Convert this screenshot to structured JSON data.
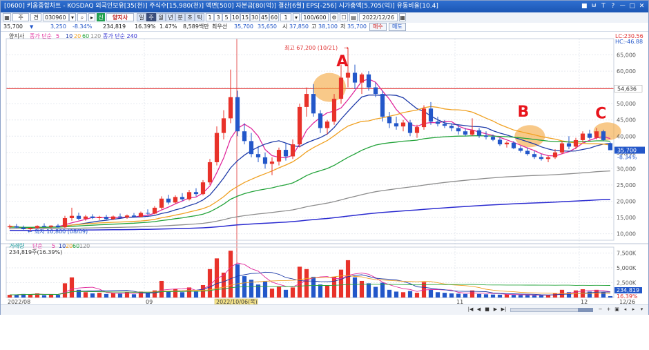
{
  "window": {
    "title": "[0600] 키움종합차트 - KOSDAQ 외국인보유[35(천)] 주식수[15,980(천)] 액면[500] 자본금[80(억)] 결산[6월] EPS[-256] 시가총액[5,705(억)] 유동비율[10.4]",
    "buttons": [
      "■",
      "ㅂ",
      "T",
      "?",
      "ㅡ",
      "□",
      "✕"
    ]
  },
  "toolbar": {
    "mode": "주",
    "market": "견",
    "code": "030960",
    "stock_name": "양지사",
    "periods": [
      "일",
      "주",
      "월",
      "년",
      "분",
      "초",
      "틱"
    ],
    "minute_options": [
      "1",
      "3",
      "5",
      "10",
      "15",
      "30",
      "45",
      "60"
    ],
    "interval_value": "1",
    "count_display": "100/600",
    "date": "2022/12/26"
  },
  "quote": {
    "price": "35,700",
    "change": "3,250",
    "change_pct": "-8.34%",
    "volume": "234,819",
    "turnover": "16.39%",
    "ratio": "1.47%",
    "amount": "8,589백만",
    "priority_label": "최우선",
    "priority_ask": "35,700",
    "priority_bid": "35,650",
    "open_label": "시",
    "open": "37,850",
    "high_label": "고",
    "high": "38,100",
    "low_label": "저",
    "low": "35,700",
    "buy_label": "매수",
    "sell_label": "매도"
  },
  "colors": {
    "up": "#e8322a",
    "down": "#2357c9",
    "ma5": "#e0289c",
    "ma10": "#1e3aa8",
    "ma20": "#f0a020",
    "ma60": "#23a33a",
    "ma120": "#8c8c8c",
    "ma240": "#2b2bd0",
    "highlight": "#f3a53a",
    "resistance": "#e03030"
  },
  "chart_data": {
    "type": "candlestick",
    "legend": {
      "stock": "양지사",
      "ma_label": "종가 단순",
      "ma_periods": [
        "5",
        "10",
        "20",
        "60",
        "120"
      ],
      "ma240_label": "종가 단순 240"
    },
    "y_price_ticks": [
      "65,000",
      "60,000",
      "55,000",
      "50,000",
      "45,000",
      "40,000",
      "35,000",
      "30,000",
      "25,000",
      "20,000",
      "15,000",
      "10,000"
    ],
    "y_price_range": [
      8000,
      70000
    ],
    "x_labels": [
      "2022/08",
      "09",
      "2022/10/06(목)",
      "11",
      "12",
      "12/26"
    ],
    "lc_label": "LC:230.56",
    "hc_label": "HC:-46.88",
    "resistance": {
      "value": 54636,
      "label": "54,636"
    },
    "last_price_label": "35,700",
    "last_change_label": "-8.34%",
    "max_annotation": "최고 67,200 (10/21)",
    "min_annotation": "최저 10,800 (08/09)",
    "markers": [
      "A",
      "B",
      "C"
    ],
    "candles": [
      {
        "o": 12000,
        "h": 12800,
        "l": 11500,
        "c": 12300
      },
      {
        "o": 12300,
        "h": 13000,
        "l": 11800,
        "c": 11900
      },
      {
        "o": 11900,
        "h": 12500,
        "l": 11200,
        "c": 11400
      },
      {
        "o": 11400,
        "h": 12000,
        "l": 10800,
        "c": 11800
      },
      {
        "o": 11800,
        "h": 12600,
        "l": 11500,
        "c": 12400
      },
      {
        "o": 12400,
        "h": 13200,
        "l": 12000,
        "c": 12100
      },
      {
        "o": 12100,
        "h": 12600,
        "l": 11700,
        "c": 12500
      },
      {
        "o": 12500,
        "h": 13000,
        "l": 11900,
        "c": 12000
      },
      {
        "o": 12000,
        "h": 15500,
        "l": 11800,
        "c": 14800
      },
      {
        "o": 14800,
        "h": 18000,
        "l": 14000,
        "c": 15500
      },
      {
        "o": 15500,
        "h": 16500,
        "l": 14200,
        "c": 14600
      },
      {
        "o": 14600,
        "h": 15800,
        "l": 14000,
        "c": 15300
      },
      {
        "o": 15300,
        "h": 16000,
        "l": 14500,
        "c": 14800
      },
      {
        "o": 14800,
        "h": 15500,
        "l": 14200,
        "c": 15200
      },
      {
        "o": 15200,
        "h": 15800,
        "l": 14300,
        "c": 14500
      },
      {
        "o": 14500,
        "h": 15600,
        "l": 14200,
        "c": 15300
      },
      {
        "o": 15300,
        "h": 16200,
        "l": 14800,
        "c": 15000
      },
      {
        "o": 15000,
        "h": 15900,
        "l": 14600,
        "c": 15600
      },
      {
        "o": 15600,
        "h": 16400,
        "l": 15000,
        "c": 15200
      },
      {
        "o": 15200,
        "h": 16800,
        "l": 15000,
        "c": 16400
      },
      {
        "o": 16400,
        "h": 17500,
        "l": 15800,
        "c": 16200
      },
      {
        "o": 16200,
        "h": 18500,
        "l": 16000,
        "c": 18000
      },
      {
        "o": 18000,
        "h": 21500,
        "l": 17500,
        "c": 20800
      },
      {
        "o": 20800,
        "h": 22000,
        "l": 19000,
        "c": 19600
      },
      {
        "o": 19600,
        "h": 21800,
        "l": 19200,
        "c": 21300
      },
      {
        "o": 21300,
        "h": 22500,
        "l": 20000,
        "c": 20600
      },
      {
        "o": 20600,
        "h": 23500,
        "l": 20200,
        "c": 22800
      },
      {
        "o": 22800,
        "h": 24000,
        "l": 21500,
        "c": 22200
      },
      {
        "o": 22200,
        "h": 26500,
        "l": 21800,
        "c": 25800
      },
      {
        "o": 25800,
        "h": 33000,
        "l": 25000,
        "c": 32000
      },
      {
        "o": 32000,
        "h": 43000,
        "l": 31000,
        "c": 41000
      },
      {
        "o": 41000,
        "h": 48000,
        "l": 39000,
        "c": 45500
      },
      {
        "o": 45500,
        "h": 60500,
        "l": 44000,
        "c": 52000
      },
      {
        "o": 52000,
        "h": 54000,
        "l": 40000,
        "c": 41500
      },
      {
        "o": 41500,
        "h": 44000,
        "l": 37500,
        "c": 38500
      },
      {
        "o": 38500,
        "h": 41000,
        "l": 33500,
        "c": 34500
      },
      {
        "o": 34500,
        "h": 37000,
        "l": 32000,
        "c": 33500
      },
      {
        "o": 33500,
        "h": 35000,
        "l": 30000,
        "c": 31500
      },
      {
        "o": 31500,
        "h": 33500,
        "l": 28000,
        "c": 32200
      },
      {
        "o": 32200,
        "h": 36500,
        "l": 31000,
        "c": 35800
      },
      {
        "o": 35800,
        "h": 38000,
        "l": 32500,
        "c": 33800
      },
      {
        "o": 33800,
        "h": 39000,
        "l": 33000,
        "c": 37500
      },
      {
        "o": 37500,
        "h": 50000,
        "l": 36500,
        "c": 49000
      },
      {
        "o": 49000,
        "h": 55000,
        "l": 46000,
        "c": 53000
      },
      {
        "o": 53000,
        "h": 56000,
        "l": 46000,
        "c": 47000
      },
      {
        "o": 47000,
        "h": 48000,
        "l": 41000,
        "c": 42500
      },
      {
        "o": 42500,
        "h": 45000,
        "l": 40500,
        "c": 44500
      },
      {
        "o": 44500,
        "h": 53000,
        "l": 43500,
        "c": 51500
      },
      {
        "o": 51500,
        "h": 62000,
        "l": 50000,
        "c": 58000
      },
      {
        "o": 58000,
        "h": 67200,
        "l": 55000,
        "c": 59500
      },
      {
        "o": 59500,
        "h": 62000,
        "l": 54500,
        "c": 56500
      },
      {
        "o": 56500,
        "h": 59500,
        "l": 53000,
        "c": 59000
      },
      {
        "o": 59000,
        "h": 60000,
        "l": 54000,
        "c": 55000
      },
      {
        "o": 55000,
        "h": 56500,
        "l": 52000,
        "c": 53000
      },
      {
        "o": 53000,
        "h": 54000,
        "l": 44500,
        "c": 46000
      },
      {
        "o": 46000,
        "h": 47500,
        "l": 42500,
        "c": 44000
      },
      {
        "o": 44000,
        "h": 46000,
        "l": 42000,
        "c": 43000
      },
      {
        "o": 43000,
        "h": 45000,
        "l": 41500,
        "c": 44200
      },
      {
        "o": 44200,
        "h": 45000,
        "l": 40000,
        "c": 41000
      },
      {
        "o": 41000,
        "h": 43500,
        "l": 39500,
        "c": 42800
      },
      {
        "o": 42800,
        "h": 49500,
        "l": 42000,
        "c": 48500
      },
      {
        "o": 48500,
        "h": 50500,
        "l": 43500,
        "c": 44500
      },
      {
        "o": 44500,
        "h": 46000,
        "l": 43000,
        "c": 43800
      },
      {
        "o": 43800,
        "h": 45000,
        "l": 42500,
        "c": 43200
      },
      {
        "o": 43200,
        "h": 44000,
        "l": 41500,
        "c": 42500
      },
      {
        "o": 42500,
        "h": 43500,
        "l": 40500,
        "c": 41500
      },
      {
        "o": 41500,
        "h": 42500,
        "l": 40000,
        "c": 40500
      },
      {
        "o": 40500,
        "h": 45500,
        "l": 40000,
        "c": 41800
      },
      {
        "o": 41800,
        "h": 42500,
        "l": 39500,
        "c": 40200
      },
      {
        "o": 40200,
        "h": 41500,
        "l": 39000,
        "c": 39800
      },
      {
        "o": 39800,
        "h": 40500,
        "l": 38500,
        "c": 38900
      },
      {
        "o": 38900,
        "h": 39500,
        "l": 37000,
        "c": 37500
      },
      {
        "o": 37500,
        "h": 38500,
        "l": 36500,
        "c": 38000
      },
      {
        "o": 38000,
        "h": 38500,
        "l": 36000,
        "c": 36300
      },
      {
        "o": 36300,
        "h": 37000,
        "l": 35000,
        "c": 35500
      },
      {
        "o": 35500,
        "h": 36500,
        "l": 34000,
        "c": 34500
      },
      {
        "o": 34500,
        "h": 35500,
        "l": 33000,
        "c": 33600
      },
      {
        "o": 33600,
        "h": 34500,
        "l": 32500,
        "c": 33000
      },
      {
        "o": 33000,
        "h": 34000,
        "l": 32000,
        "c": 33500
      },
      {
        "o": 33500,
        "h": 36000,
        "l": 33000,
        "c": 35000
      },
      {
        "o": 35000,
        "h": 38500,
        "l": 34500,
        "c": 37800
      },
      {
        "o": 37800,
        "h": 40000,
        "l": 36000,
        "c": 36800
      },
      {
        "o": 36800,
        "h": 39500,
        "l": 36000,
        "c": 38800
      },
      {
        "o": 38800,
        "h": 41500,
        "l": 38000,
        "c": 40800
      },
      {
        "o": 40800,
        "h": 42000,
        "l": 39000,
        "c": 39500
      },
      {
        "o": 39500,
        "h": 42500,
        "l": 39000,
        "c": 41500
      },
      {
        "o": 41500,
        "h": 42000,
        "l": 38500,
        "c": 38800
      },
      {
        "o": 37850,
        "h": 38100,
        "l": 35700,
        "c": 35700
      }
    ],
    "volume_legend": {
      "label": "거래량",
      "ma_label": "단순",
      "ma_periods": [
        "5",
        "10",
        "20",
        "60",
        "120"
      ],
      "summary": "234,819주(16.39%)"
    },
    "volume_ticks": [
      "7,500K",
      "5,000K",
      "2,500K"
    ],
    "volume_range": [
      0,
      8500000
    ],
    "volume_last_labels": [
      "234,819",
      "16.39%"
    ],
    "volumes": [
      450000,
      500000,
      600000,
      550000,
      700000,
      400000,
      500000,
      450000,
      2400000,
      3400000,
      1300000,
      900000,
      700000,
      800000,
      600000,
      750000,
      650000,
      900000,
      550000,
      1000000,
      700000,
      1200000,
      2800000,
      1100000,
      1400000,
      900000,
      1700000,
      1000000,
      2100000,
      4800000,
      6600000,
      4200000,
      7900000,
      5600000,
      3600000,
      3000000,
      2200000,
      2700000,
      1500000,
      1800000,
      1300000,
      1700000,
      5200000,
      4800000,
      3500000,
      2200000,
      2000000,
      3500000,
      4700000,
      6300000,
      3400000,
      2800000,
      2400000,
      1800000,
      2500000,
      1300000,
      1000000,
      900000,
      1100000,
      800000,
      2600000,
      1300000,
      900000,
      800000,
      700000,
      650000,
      600000,
      1200000,
      600000,
      550000,
      500000,
      480000,
      520000,
      450000,
      420000,
      400000,
      380000,
      350000,
      420000,
      700000,
      1300000,
      900000,
      1200000,
      1400000,
      1000000,
      1300000,
      900000,
      234819
    ]
  }
}
